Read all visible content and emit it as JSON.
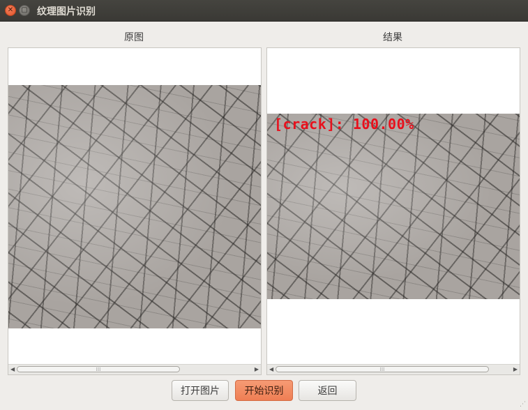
{
  "window": {
    "title": "纹理图片识别",
    "close_glyph": "✕",
    "maximize_glyph": "▢"
  },
  "left_panel": {
    "label": "原图",
    "scroll_thumb_glyph": "⁞⁞⁞"
  },
  "right_panel": {
    "label": "结果",
    "overlay_text": "[crack]: 100.00%",
    "overlay_color": "#e8101c",
    "scroll_thumb_glyph": "⁞⁞⁞"
  },
  "buttons": {
    "open_image": "打开图片",
    "start_recognition": "开始识别",
    "back": "返回"
  },
  "colors": {
    "accent": "#ef7e54",
    "titlebar": "#3e3d39"
  }
}
